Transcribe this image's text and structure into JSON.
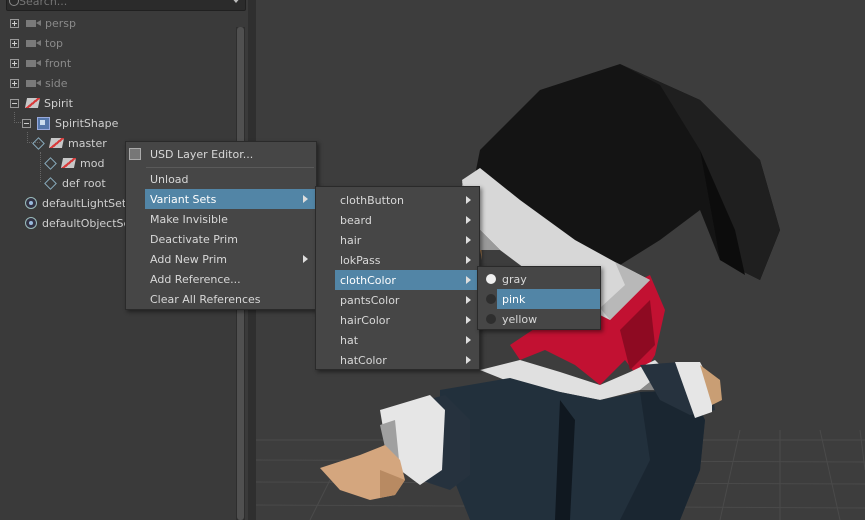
{
  "outliner": {
    "search_placeholder": "Search...",
    "items": [
      {
        "label": "persp"
      },
      {
        "label": "top"
      },
      {
        "label": "front"
      },
      {
        "label": "side"
      },
      {
        "label": "Spirit"
      },
      {
        "label": "SpiritShape"
      },
      {
        "label": "master"
      },
      {
        "label": "mod"
      },
      {
        "label": "root"
      },
      {
        "label": "defaultLightSet"
      },
      {
        "label": "defaultObjectSet"
      }
    ]
  },
  "context_menu": {
    "items": [
      {
        "label": "USD Layer Editor..."
      },
      {
        "label": "Unload"
      },
      {
        "label": "Variant Sets"
      },
      {
        "label": "Make Invisible"
      },
      {
        "label": "Deactivate Prim"
      },
      {
        "label": "Add New Prim"
      },
      {
        "label": "Add Reference..."
      },
      {
        "label": "Clear All References"
      }
    ]
  },
  "variant_sets_menu": {
    "items": [
      {
        "label": "clothButton"
      },
      {
        "label": "beard"
      },
      {
        "label": "hair"
      },
      {
        "label": "lokPass"
      },
      {
        "label": "clothColor"
      },
      {
        "label": "pantsColor"
      },
      {
        "label": "hairColor"
      },
      {
        "label": "hat"
      },
      {
        "label": "hatColor"
      }
    ]
  },
  "cloth_color_menu": {
    "selected": "gray",
    "items": [
      {
        "label": "gray"
      },
      {
        "label": "pink"
      },
      {
        "label": "yellow"
      }
    ]
  },
  "colors": {
    "highlight": "#5285a6",
    "menu_bg": "#464646",
    "panel_bg": "#3a3a3a"
  }
}
